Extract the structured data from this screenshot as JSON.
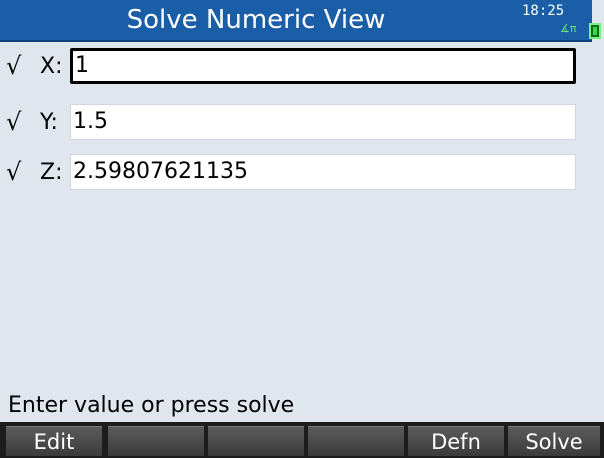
{
  "header": {
    "title": "Solve Numeric View",
    "clock": "18:25",
    "angle_mode": "∡π"
  },
  "variables": [
    {
      "check": "√",
      "label": "X:",
      "value": "1"
    },
    {
      "check": "√",
      "label": "Y:",
      "value": "1.5"
    },
    {
      "check": "√",
      "label": "Z:",
      "value": "2.59807621135"
    }
  ],
  "status": {
    "prompt": "Enter value or press solve"
  },
  "menu": [
    "Edit",
    "",
    "",
    "",
    "Defn",
    "Solve"
  ],
  "colors": {
    "title_bg": "#1b5ea8",
    "screen_bg": "#dfe6ee",
    "menu_bg": "#1d1d1d"
  }
}
